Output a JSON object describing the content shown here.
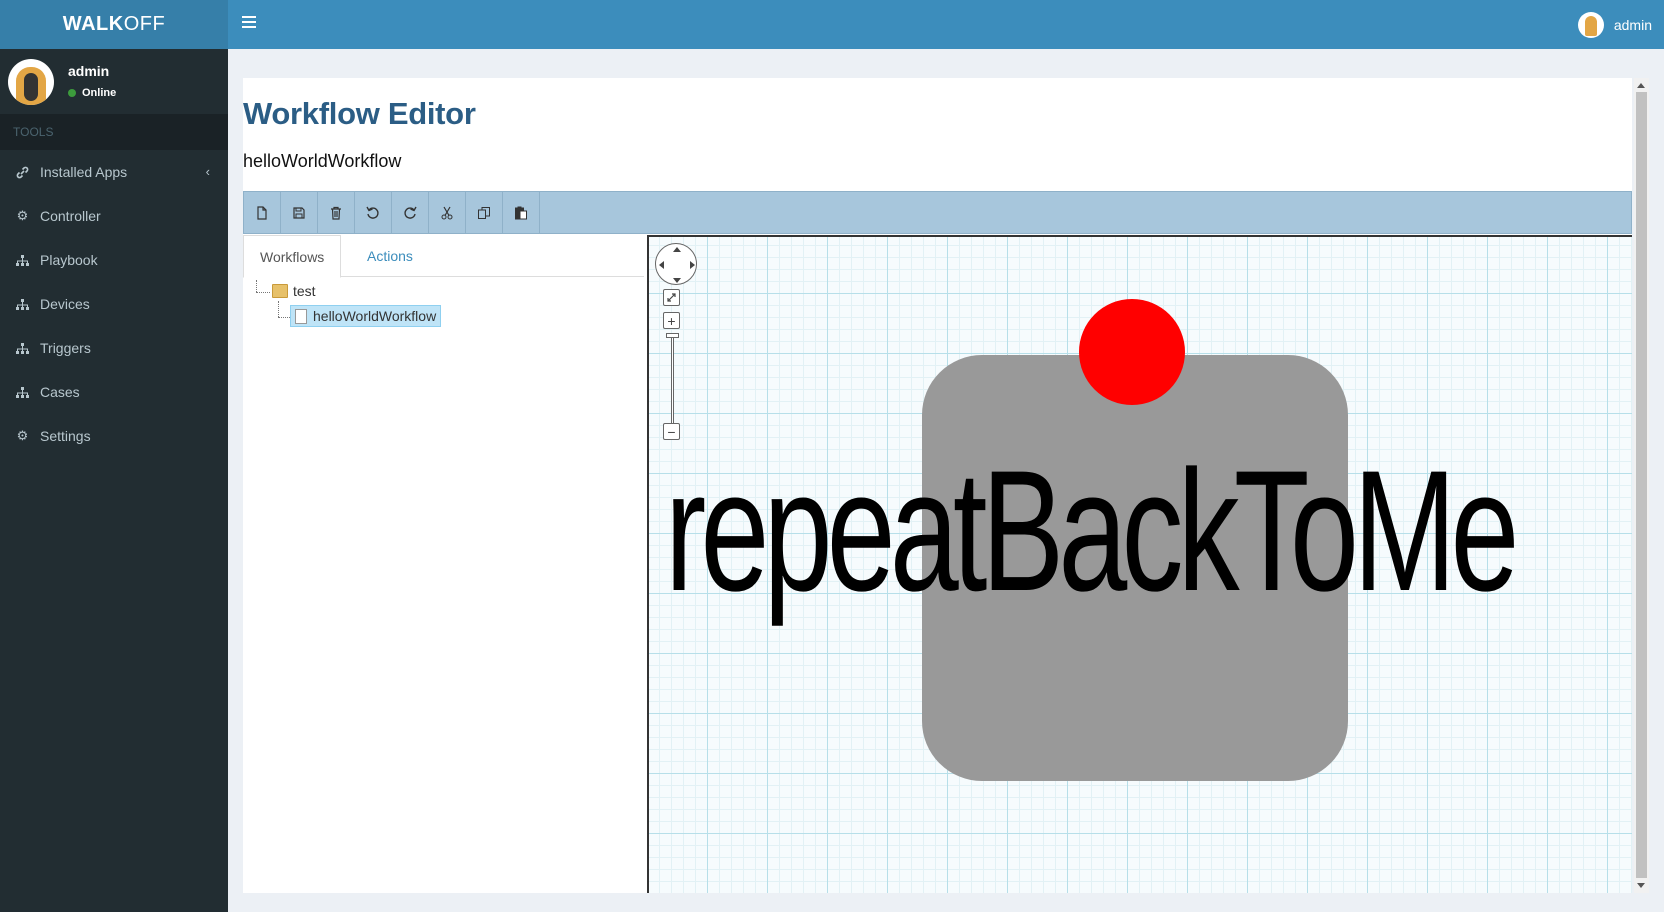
{
  "app": {
    "logo_bold": "WALK",
    "logo_light": "OFF",
    "brand_color": "#3c8dbc"
  },
  "topbar": {
    "username": "admin"
  },
  "sidebar": {
    "user_name": "admin",
    "user_status": "Online",
    "section_label": "TOOLS",
    "items": [
      {
        "label": "Installed Apps",
        "icon": "link-icon"
      },
      {
        "label": "Controller",
        "icon": "gear-icon"
      },
      {
        "label": "Playbook",
        "icon": "sitemap-icon"
      },
      {
        "label": "Devices",
        "icon": "sitemap-icon"
      },
      {
        "label": "Triggers",
        "icon": "sitemap-icon"
      },
      {
        "label": "Cases",
        "icon": "sitemap-icon"
      },
      {
        "label": "Settings",
        "icon": "gear-icon"
      }
    ]
  },
  "page": {
    "title": "Workflow Editor",
    "workflow_name": "helloWorldWorkflow"
  },
  "toolbar": {
    "buttons": [
      "new-file-icon",
      "save-icon",
      "trash-icon",
      "undo-icon",
      "redo-icon",
      "cut-icon",
      "copy-icon",
      "paste-icon"
    ]
  },
  "tabs": {
    "workflows": "Workflows",
    "actions": "Actions"
  },
  "tree": {
    "folder": "test",
    "file": "helloWorldWorkflow"
  },
  "canvas": {
    "node_label": "repeatBackToMe",
    "node_color": "#999999",
    "start_marker_color": "#ff0000"
  }
}
